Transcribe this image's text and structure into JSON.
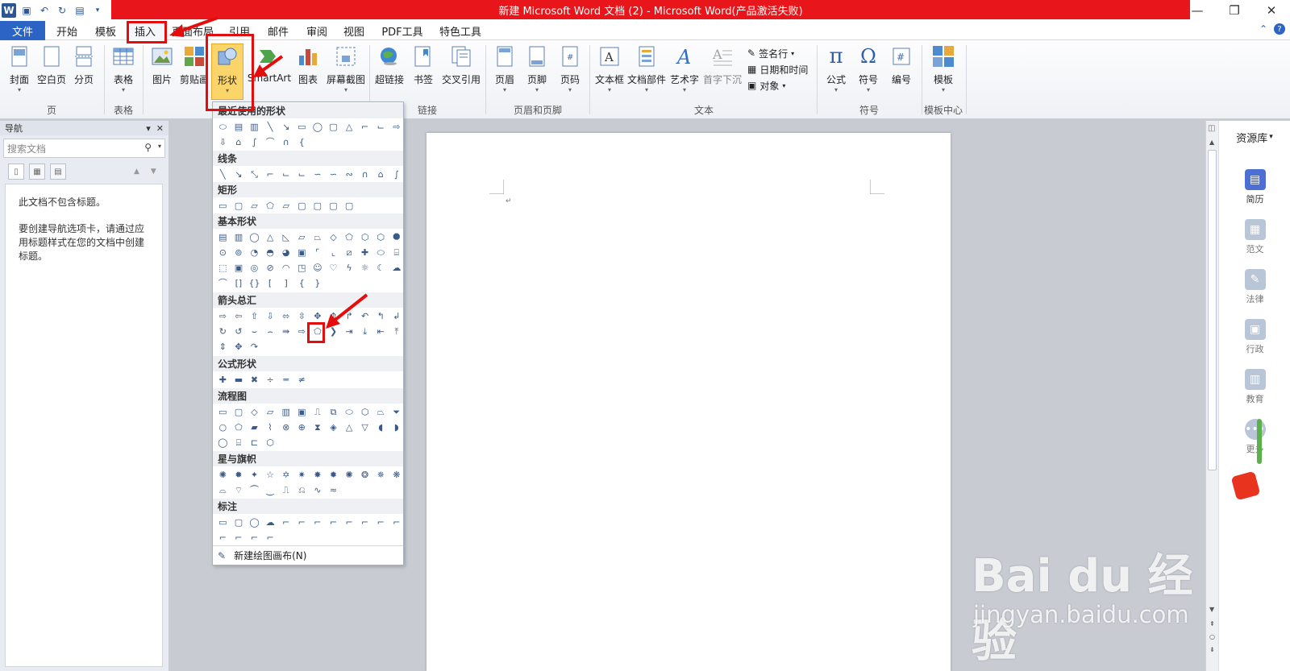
{
  "title_bar": {
    "title": "新建 Microsoft Word 文档 (2) - Microsoft Word(产品激活失败)",
    "controls": [
      "—",
      "❐",
      "✕"
    ]
  },
  "menu": {
    "file": "文件",
    "tabs": [
      "开始",
      "模板",
      "插入",
      "页面布局",
      "引用",
      "邮件",
      "审阅",
      "视图",
      "PDF工具",
      "特色工具"
    ]
  },
  "ribbon": {
    "page_group": {
      "label": "页",
      "buttons": [
        "封面",
        "空白页",
        "分页"
      ]
    },
    "table_group": {
      "label": "表格",
      "buttons": [
        "表格"
      ]
    },
    "illustrations": {
      "buttons": [
        "图片",
        "剪贴画",
        "形状",
        "SmartArt",
        "图表",
        "屏幕截图"
      ]
    },
    "links_group": {
      "label": "链接",
      "buttons": [
        "超链接",
        "书签",
        "交叉引用"
      ]
    },
    "header_footer_group": {
      "label": "页眉和页脚",
      "buttons": [
        "页眉",
        "页脚",
        "页码"
      ]
    },
    "text_group": {
      "label": "文本",
      "buttons": [
        "文本框",
        "文档部件",
        "艺术字",
        "首字下沉"
      ],
      "small": [
        "签名行",
        "日期和时间",
        "对象"
      ]
    },
    "symbols_group": {
      "label": "符号",
      "buttons": [
        "公式",
        "符号",
        "编号"
      ]
    },
    "template_group": {
      "label": "模板中心",
      "buttons": [
        "模板"
      ]
    }
  },
  "nav": {
    "title": "导航",
    "search_placeholder": "搜索文档",
    "msg1": "此文档不包含标题。",
    "msg2": "要创建导航选项卡，请通过应用标题样式在您的文档中创建标题。"
  },
  "shapes_menu": {
    "sections": [
      "最近使用的形状",
      "线条",
      "矩形",
      "基本形状",
      "箭头总汇",
      "公式形状",
      "流程图",
      "星与旗帜",
      "标注"
    ],
    "new_canvas": "新建绘图画布(N)"
  },
  "resource_panel": {
    "title": "资源库",
    "items": [
      "简历",
      "范文",
      "法律",
      "行政",
      "教育",
      "更多"
    ]
  },
  "watermark": {
    "main": "Bai du 经验",
    "sub": "jingyan.baidu.com"
  },
  "colors": {
    "title_red": "#e8161a",
    "file_blue": "#2b64c4",
    "annotation": "#e30d0d"
  }
}
